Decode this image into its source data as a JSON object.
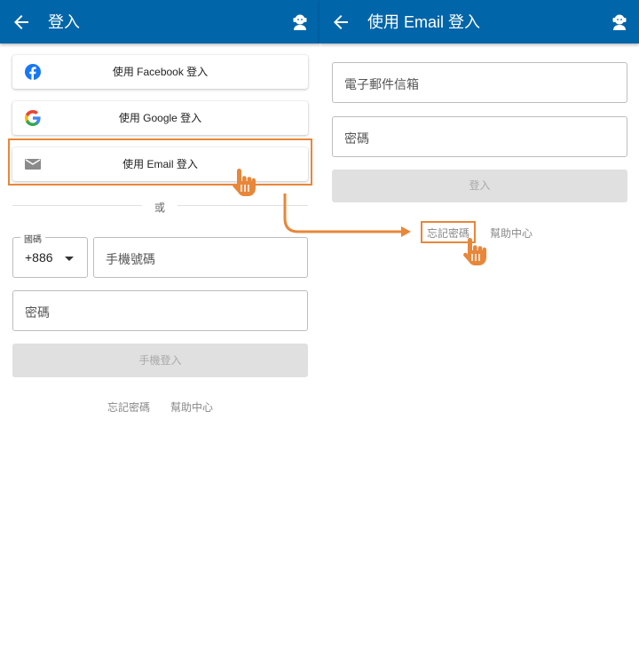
{
  "left": {
    "appbar": {
      "title": "登入",
      "back_icon": "arrow-left-icon",
      "support_icon": "customer-service-icon"
    },
    "social": {
      "facebook_label": "使用 Facebook 登入",
      "google_label": "使用 Google 登入",
      "email_label": "使用 Email 登入"
    },
    "or_label": "或",
    "phone": {
      "country_code_label": "國碼",
      "country_code_value": "+886",
      "phone_placeholder": "手機號碼",
      "password_placeholder": "密碼",
      "submit_label": "手機登入"
    },
    "links": {
      "forgot": "忘記密碼",
      "help": "幫助中心"
    }
  },
  "right": {
    "appbar": {
      "title": "使用 Email 登入",
      "back_icon": "arrow-left-icon",
      "support_icon": "customer-service-icon"
    },
    "email_placeholder": "電子郵件信箱",
    "password_placeholder": "密碼",
    "submit_label": "登入",
    "links": {
      "forgot": "忘記密碼",
      "help": "幫助中心"
    }
  },
  "colors": {
    "appbar": "#0065a9",
    "highlight": "#e8873a",
    "facebook": "#1877f2",
    "disabled_button": "#e0e0e0"
  }
}
